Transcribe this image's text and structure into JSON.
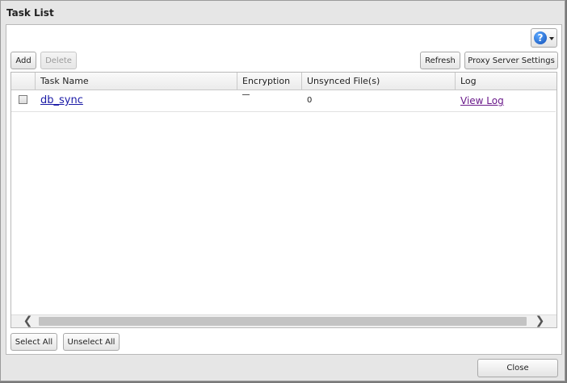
{
  "dialog": {
    "title": "Task List"
  },
  "toolbar": {
    "help_glyph": "?",
    "add_label": "Add",
    "delete_label": "Delete",
    "refresh_label": "Refresh",
    "proxy_label": "Proxy Server Settings"
  },
  "table": {
    "columns": [
      "",
      "Task Name",
      "Encryption",
      "Unsynced File(s)",
      "Log"
    ],
    "rows": [
      {
        "task_name": "db_sync",
        "encryption": "",
        "unsynced_files": "0",
        "log_label": "View Log"
      }
    ]
  },
  "scrollbar": {
    "left_arrow": "❮",
    "right_arrow": "❯"
  },
  "footer": {
    "select_all_label": "Select All",
    "unselect_all_label": "Unselect All",
    "close_label": "Close"
  },
  "colors": {
    "link": "#1a1aa6",
    "visited_link": "#6a1a8a",
    "help_icon": "#1250b8"
  },
  "icons": {
    "help": "help-icon",
    "dropdown": "chevron-down-icon",
    "scroll_left": "chevron-left-icon",
    "scroll_right": "chevron-right-icon"
  }
}
